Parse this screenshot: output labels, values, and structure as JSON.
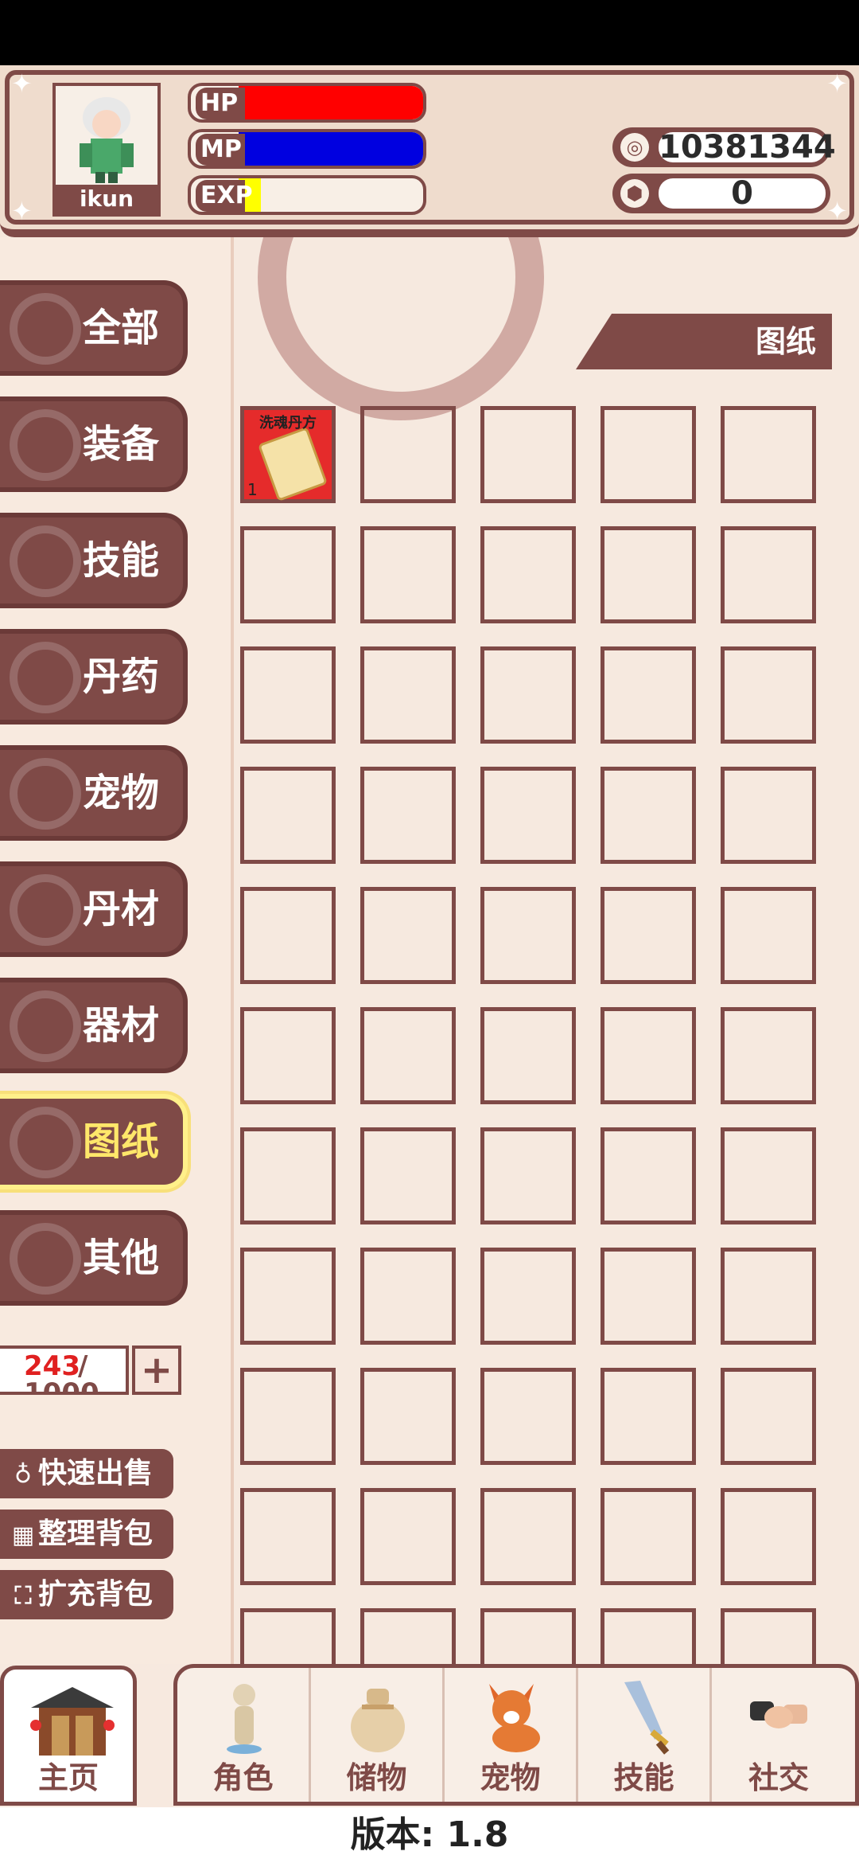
{
  "player": {
    "name": "ikun",
    "hp_label": "HP",
    "mp_label": "MP",
    "exp_label": "EXP",
    "hp_fraction": 1.0,
    "mp_fraction": 1.0,
    "exp_fraction": 0.12
  },
  "currency": {
    "coins": "10381344",
    "gems": "0"
  },
  "sidebar": {
    "items": [
      {
        "label": "全部"
      },
      {
        "label": "装备"
      },
      {
        "label": "技能"
      },
      {
        "label": "丹药"
      },
      {
        "label": "宠物"
      },
      {
        "label": "丹材"
      },
      {
        "label": "器材"
      },
      {
        "label": "图纸"
      },
      {
        "label": "其他"
      }
    ],
    "active_index": 7,
    "capacity_used": "243",
    "capacity_slash": "/",
    "capacity_total": "1000",
    "capacity_add": "+",
    "actions": [
      {
        "label": "快速出售"
      },
      {
        "label": "整理背包"
      },
      {
        "label": "扩充背包"
      }
    ]
  },
  "main": {
    "category_title": "图纸",
    "items": [
      {
        "name": "洗魂丹方",
        "qty": "1"
      }
    ]
  },
  "bottom_nav": {
    "home": "主页",
    "tabs": [
      {
        "label": "角色"
      },
      {
        "label": "储物"
      },
      {
        "label": "宠物"
      },
      {
        "label": "技能"
      },
      {
        "label": "社交"
      }
    ]
  },
  "version": "版本: 1.8"
}
